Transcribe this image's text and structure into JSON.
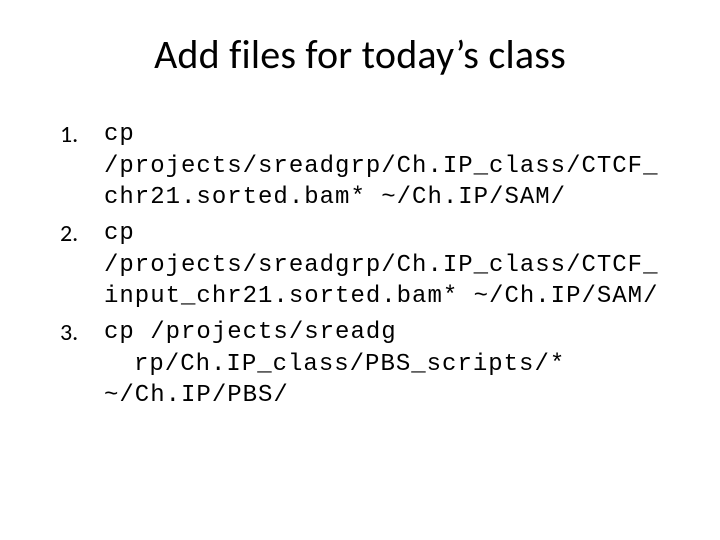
{
  "title": "Add files for today’s class",
  "items": [
    {
      "marker": "1.",
      "lines": [
        "cp",
        "/projects/sreadgrp/Ch.IP_class/CTCF_",
        "chr21.sorted.bam* ~/Ch.IP/SAM/"
      ]
    },
    {
      "marker": "2.",
      "lines": [
        "cp",
        "/projects/sreadgrp/Ch.IP_class/CTCF_",
        "input_chr21.sorted.bam* ~/Ch.IP/SAM/"
      ]
    },
    {
      "marker": "3.",
      "lines": [
        "cp /projects/sreadg",
        "rp/Ch.IP_class/PBS_scripts/*",
        "~/Ch.IP/PBS/"
      ],
      "indentFirstContinuation": true
    }
  ]
}
